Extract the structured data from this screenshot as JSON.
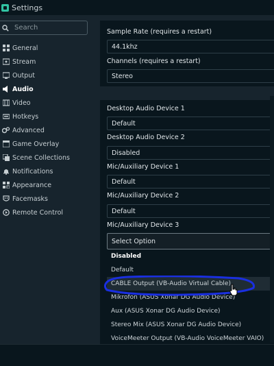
{
  "window": {
    "title": "Settings"
  },
  "search": {
    "placeholder": "Search"
  },
  "sidebar": {
    "items": [
      {
        "label": "General",
        "icon": "grid-icon"
      },
      {
        "label": "Stream",
        "icon": "broadcast-icon"
      },
      {
        "label": "Output",
        "icon": "output-icon"
      },
      {
        "label": "Audio",
        "icon": "speaker-icon",
        "active": true
      },
      {
        "label": "Video",
        "icon": "film-icon"
      },
      {
        "label": "Hotkeys",
        "icon": "keyboard-icon"
      },
      {
        "label": "Advanced",
        "icon": "gears-icon"
      },
      {
        "label": "Game Overlay",
        "icon": "window-icon"
      },
      {
        "label": "Scene Collections",
        "icon": "collection-icon"
      },
      {
        "label": "Notifications",
        "icon": "bell-icon"
      },
      {
        "label": "Appearance",
        "icon": "palette-icon"
      },
      {
        "label": "Facemasks",
        "icon": "mask-icon"
      },
      {
        "label": "Remote Control",
        "icon": "remote-icon"
      }
    ]
  },
  "general_audio": {
    "sample_rate_label": "Sample Rate (requires a restart)",
    "sample_rate_value": "44.1khz",
    "channels_label": "Channels (requires a restart)",
    "channels_value": "Stereo"
  },
  "devices": {
    "desktop1_label": "Desktop Audio Device 1",
    "desktop1_value": "Default",
    "desktop2_label": "Desktop Audio Device 2",
    "desktop2_value": "Disabled",
    "mic1_label": "Mic/Auxiliary Device 1",
    "mic1_value": "Default",
    "mic2_label": "Mic/Auxiliary Device 2",
    "mic2_value": "Default",
    "mic3_label": "Mic/Auxiliary Device 3",
    "mic3_value": "Select Option"
  },
  "dropdown": {
    "options": [
      "Disabled",
      "Default",
      "CABLE Output (VB-Audio Virtual Cable)",
      "Mikrofon (ASUS Xonar DG Audio Device)",
      "Aux (ASUS Xonar DG Audio Device)",
      "Stereo Mix (ASUS Xonar DG Audio Device)",
      "VoiceMeeter Output (VB-Audio VoiceMeeter VAIO)"
    ]
  },
  "colors": {
    "background": "#17242d",
    "panel": "#09161d",
    "accent": "#31c3a2",
    "annotation": "#1a2fe0"
  }
}
